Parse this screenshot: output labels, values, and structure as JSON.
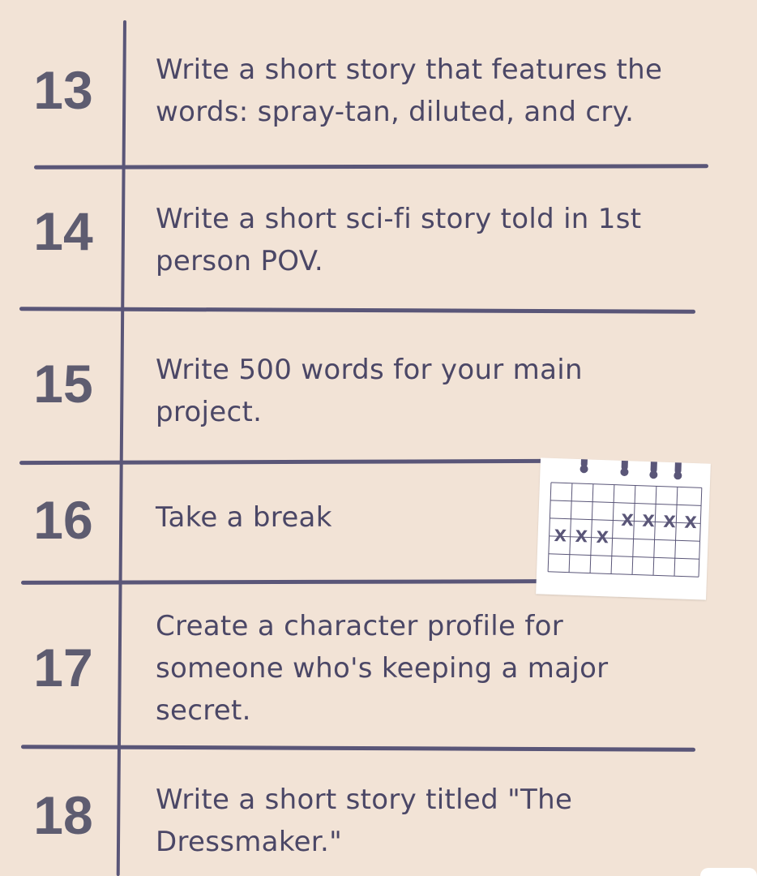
{
  "prompts": [
    {
      "number": "13",
      "text": "Write a short story that features the words: spray-tan, diluted, and cry."
    },
    {
      "number": "14",
      "text": "Write a short sci-fi story told in 1st person POV."
    },
    {
      "number": "15",
      "text": "Write 500 words for your main project."
    },
    {
      "number": "16",
      "text": "Take a break"
    },
    {
      "number": "17",
      "text": "Create a character profile for someone who's keeping a major secret."
    },
    {
      "number": "18",
      "text": "Write a short story titled \"The Dressmaker.\""
    }
  ],
  "calendar": {
    "icon": "calendar-icon",
    "marks": [
      "X",
      "X",
      "X",
      "X",
      "X",
      "X",
      "X"
    ]
  },
  "colors": {
    "background": "#f2e3d6",
    "ink": "#5a5678",
    "number": "#5e5c70"
  }
}
